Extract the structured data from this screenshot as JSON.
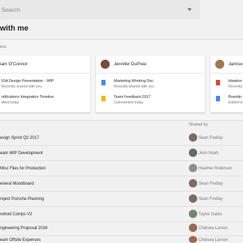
{
  "search": {
    "placeholder": "Search"
  },
  "page_title": "with me",
  "section_label": "ess",
  "cards": [
    {
      "name": "iam O'Connor",
      "avatar_color": "#c8c8c8",
      "docs": [
        {
          "icon": "slides-icon",
          "color": "#f4b400",
          "title": "IGA Design Presentation - WIP",
          "sub": "Recently shared with you"
        },
        {
          "icon": "docs-icon",
          "color": "#4a86e8",
          "title": "otifications Integration Timeline",
          "sub": "dited today"
        }
      ]
    },
    {
      "name": "Jennifer DuPree",
      "avatar_color": "#7a4a3a",
      "docs": [
        {
          "icon": "docs-icon",
          "color": "#4a86e8",
          "title": "Marketing Working Doc",
          "sub": "Recently shared with you"
        },
        {
          "icon": "slides-icon",
          "color": "#f4b400",
          "title": "Team Feedback 2017",
          "sub": "Commented today"
        }
      ]
    },
    {
      "name": "Jamiso",
      "avatar_color": "#a07850",
      "docs": [
        {
          "icon": "pdf-icon",
          "color": "#db4437",
          "title": "Ideation",
          "sub": "Recently"
        },
        {
          "icon": "docs-icon",
          "color": "#4a86e8",
          "title": "Brandin",
          "sub": "Edited to"
        }
      ]
    }
  ],
  "table": {
    "shared_by_header": "Shared by",
    "rows": [
      {
        "name": "esign Sprint Q2 2017",
        "person": "Sean Findlay",
        "avatar_color": "#7d6b62"
      },
      {
        "name": "eam WIP Development",
        "person": "Josh Noah",
        "avatar_color": "#5c6f62"
      },
      {
        "name": "Misc Files for Production",
        "person": "Heather Robinson",
        "avatar_color": "#8f8f8f"
      },
      {
        "name": "eneral Moodboard",
        "person": "Sean Findlay",
        "avatar_color": "#7d6b62"
      },
      {
        "name": "roject Porsche Planning",
        "person": "Sean Findlay",
        "avatar_color": "#7d6b62"
      },
      {
        "name": "ndroid Comps V2",
        "person": "Taylor Oates",
        "avatar_color": "#6f8a6a"
      },
      {
        "name": "ngineering Proposal 2016",
        "person": "Chelsea Larson",
        "avatar_color": "#9a6a50"
      },
      {
        "name": "eam Offsite Expenses",
        "person": "Chelsea Larson",
        "avatar_color": "#9a6a50"
      }
    ]
  }
}
